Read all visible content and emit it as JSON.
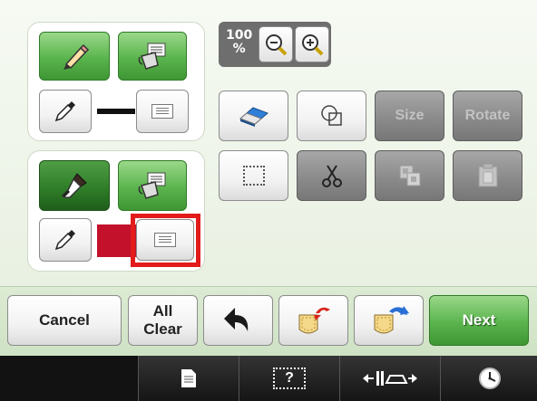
{
  "zoom": {
    "value": "100",
    "unit": "%"
  },
  "tools_grey": {
    "size_label": "Size",
    "rotate_label": "Rotate"
  },
  "colors": {
    "line_color": "#111111",
    "fill_color": "#c3112b"
  },
  "bottom_bar": {
    "cancel_label": "Cancel",
    "all_clear_label_1": "All",
    "all_clear_label_2": "Clear",
    "next_label": "Next"
  },
  "status_bar": {
    "help_label": "?"
  }
}
